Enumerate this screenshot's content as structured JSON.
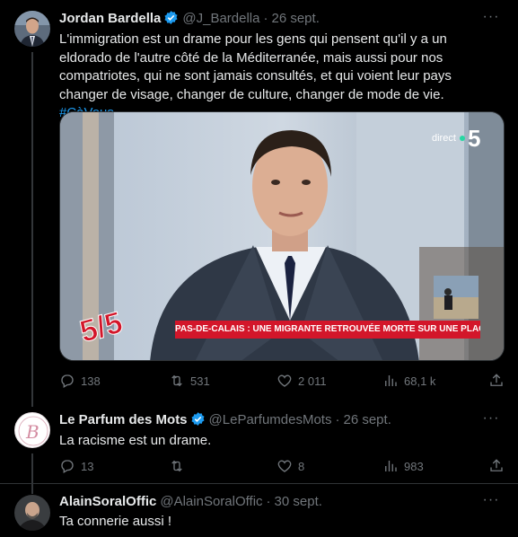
{
  "tweets": [
    {
      "name": "Jordan Bardella",
      "handle": "@J_Bardella",
      "date": "26 sept.",
      "text": "L'immigration est un drame pour les gens qui pensent qu'il y a un eldorado de l'autre côté de la Méditerranée, mais aussi pour nos compatriotes, qui ne sont jamais consultés, et qui voient leur pays changer de visage, changer de culture, changer de mode de vie.",
      "hashtag": "#CàVous",
      "media": {
        "channel_label": "direct",
        "channel_number": "5",
        "show_logo": "5/5",
        "banner_text": "PAS-DE-CALAIS : UNE MIGRANTE RETROUVÉE MORTE SUR UNE PLAGE"
      },
      "stats": {
        "replies": "138",
        "retweets": "531",
        "likes": "2 011",
        "views": "68,1 k"
      }
    },
    {
      "name": "Le Parfum des Mots",
      "handle": "@LeParfumdesMots",
      "date": "26 sept.",
      "text": "La racisme est un drame.",
      "stats": {
        "replies": "13",
        "retweets": "",
        "likes": "8",
        "views": "983"
      }
    },
    {
      "name": "AlainSoralOffic",
      "handle": "@AlainSoralOffic",
      "date": "30 sept.",
      "text": "Ta connerie aussi !"
    }
  ],
  "more_glyph": "···",
  "colors": {
    "accent": "#1d9bf0",
    "muted": "#71767b",
    "text": "#e7e9ea",
    "bg": "#000000",
    "banner": "#d3162a"
  },
  "icons": [
    "reply-icon",
    "retweet-icon",
    "like-icon",
    "views-icon",
    "share-icon",
    "verified-badge-icon",
    "more-icon"
  ]
}
